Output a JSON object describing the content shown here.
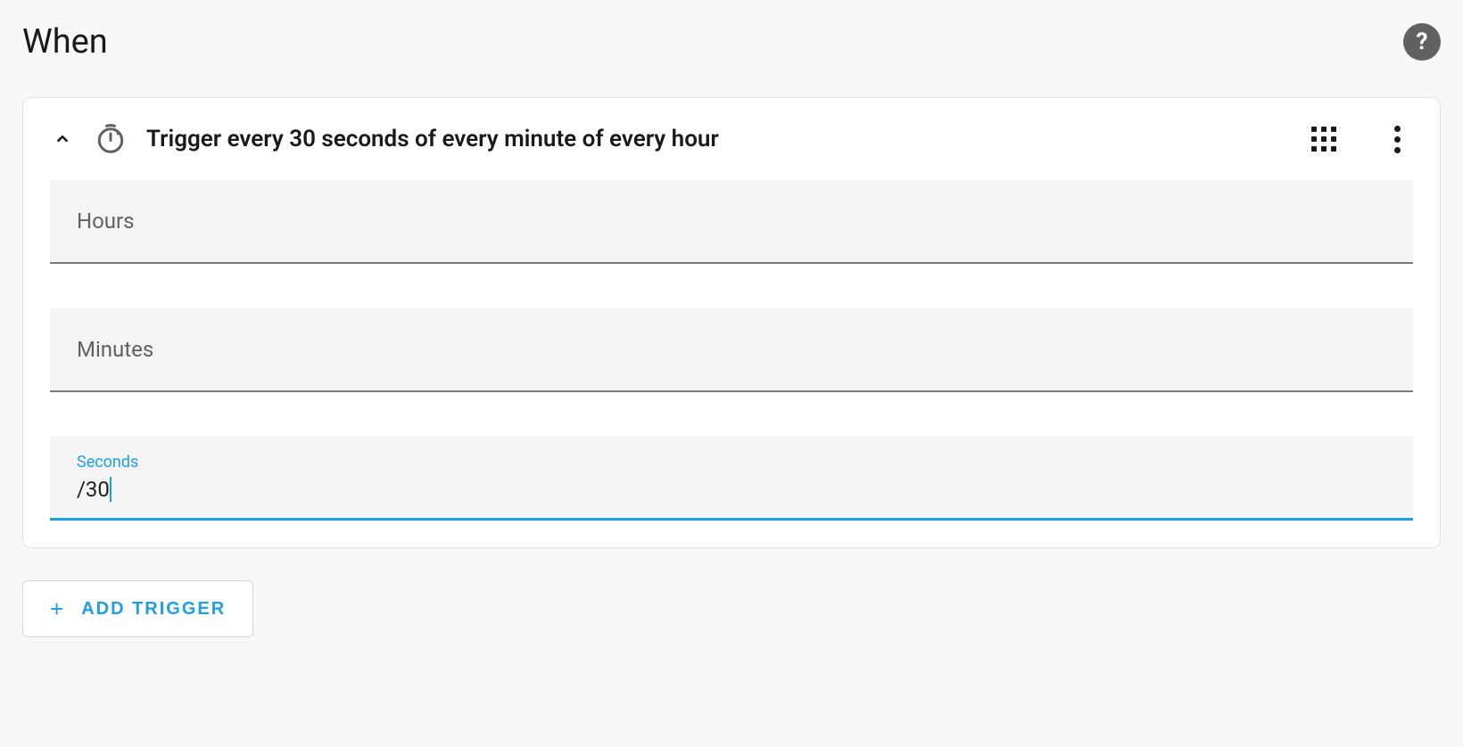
{
  "section": {
    "title": "When"
  },
  "trigger": {
    "summary": "Trigger every 30 seconds of every minute of every hour",
    "fields": {
      "hours": {
        "label": "Hours",
        "value": ""
      },
      "minutes": {
        "label": "Minutes",
        "value": ""
      },
      "seconds": {
        "label": "Seconds",
        "value": "/30"
      }
    }
  },
  "actions": {
    "add_trigger": "ADD TRIGGER"
  }
}
